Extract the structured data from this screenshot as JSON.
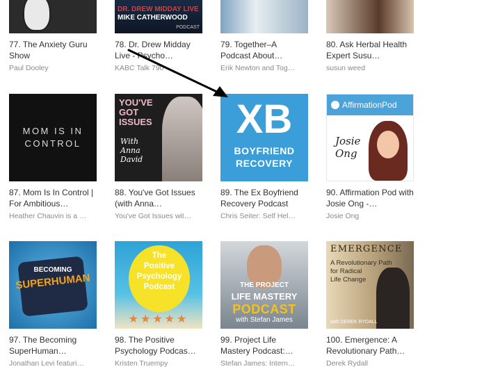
{
  "rows": [
    {
      "items": [
        {
          "rank_title": "77. The Anxiety Guru Show",
          "author": "Paul Dooley"
        },
        {
          "rank_title": "78. Dr. Drew Midday Live - Psycho…",
          "author": "KABC Talk 790",
          "art_line1": "DR. DREW MIDDAY LIVE",
          "art_line2": "MIKE CATHERWOOD",
          "art_line3": "PODCAST"
        },
        {
          "rank_title": "79. Together–A Podcast About…",
          "author": "Erik Newton and Tog…"
        },
        {
          "rank_title": "80. Ask Herbal Health Expert Susu…",
          "author": "susun weed"
        }
      ]
    },
    {
      "items": [
        {
          "rank_title": "87. Mom Is In Control | For Ambitious…",
          "author": "Heather Chauvin is a …",
          "art_lines": [
            "MOM IS IN",
            "CONTROL"
          ]
        },
        {
          "rank_title": "88. You've Got Issues (with Anna…",
          "author": "You've Got Issues wit…",
          "art_title": "YOU'VE\nGOT\nISSUES",
          "art_sub": "With\nAnna\nDavid"
        },
        {
          "rank_title": "89. The Ex Boyfriend Recovery Podcast",
          "author": "Chris Seiter: Self Hel…",
          "art_mark": "XB",
          "art_w1": "BOYFRIEND",
          "art_w2": "RECOVERY"
        },
        {
          "rank_title": "90. Affirmation Pod with Josie Ong -…",
          "author": "Josie Ong",
          "art_brand": "AffirmationPod",
          "art_name": "Josie\nOng"
        }
      ]
    },
    {
      "items": [
        {
          "rank_title": "97. The Becoming SuperHuman Podcast…",
          "author": "Jonathan Levi featuri…",
          "art_b1": "BECOMING",
          "art_b2": "SUPERHUMAN"
        },
        {
          "rank_title": "98. The Positive Psychology Podcas…",
          "author": "Kristen Truempy",
          "art_text": "The\nPositive\nPsychology\nPodcast",
          "art_stars": "★★★★★"
        },
        {
          "rank_title": "99. Project Life Mastery Podcast:…",
          "author": "Stefan James: Intern…",
          "art_l1": "THE PROJECT",
          "art_l2": "LIFE MASTERY",
          "art_l3": "PODCAST",
          "art_l4": "with Stefan James"
        },
        {
          "rank_title": "100. Emergence: A Revolutionary Path…",
          "author": "Derek Rydall",
          "art_h": "EMERGENCE",
          "art_s": "A Revolutionary Path\nfor Radical\nLife Change",
          "art_f": "with DEREK RYDALL"
        }
      ]
    }
  ],
  "colors": {
    "title": "#333333",
    "author": "#8a8a8a",
    "arrow": "#000000"
  }
}
